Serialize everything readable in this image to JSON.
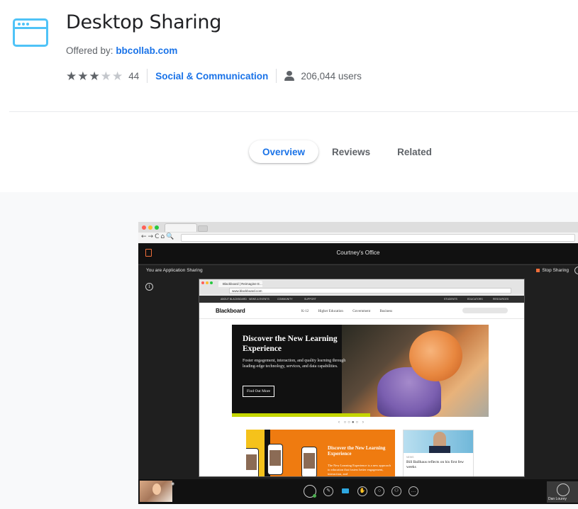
{
  "header": {
    "title": "Desktop Sharing",
    "offered_prefix": "Offered by:",
    "offered_by": "bbcollab.com",
    "rating": 3,
    "rating_max": 5,
    "rating_count": "44",
    "category": "Social & Communication",
    "users": "206,044 users"
  },
  "tabs": [
    {
      "label": "Overview",
      "active": true
    },
    {
      "label": "Reviews",
      "active": false
    },
    {
      "label": "Related",
      "active": false
    }
  ],
  "screenshot": {
    "room_title": "Courtney's Office",
    "sharing_status": "You are Application Sharing",
    "stop_sharing": "Stop Sharing",
    "inner_tab": "Blackboard | Reimagine E...",
    "inner_url": "www.blackboard.com",
    "inner_nav_left": [
      "ABOUT BLACKBOARD",
      "NEWS & EVENTS",
      "COMMUNITY",
      "SUPPORT"
    ],
    "inner_nav_right": [
      "STUDENTS",
      "EDUCATORS",
      "RESOURCES"
    ],
    "site_logo": "Blackboard",
    "site_links": [
      "K-12",
      "Higher Education",
      "Government",
      "Business"
    ],
    "hero_title": "Discover the New Learning Experience",
    "hero_text": "Foster engagement, interaction, and quality learning through leading-edge technology, services, and data capabilities.",
    "hero_button": "Find Out More",
    "card1_title": "Discover the New Learning Experience",
    "card1_text": "The New Learning Experience is a new approach to education that fosters better engagement, interaction, and",
    "card2_label": "NEWS",
    "card2_title": "Bill Ballhaus reflects on his first few weeks",
    "participant": "Dan Lourey"
  },
  "colors": {
    "accent": "#1a73e8",
    "icon": "#4fc3f7",
    "share_orange": "#f06e3a"
  }
}
